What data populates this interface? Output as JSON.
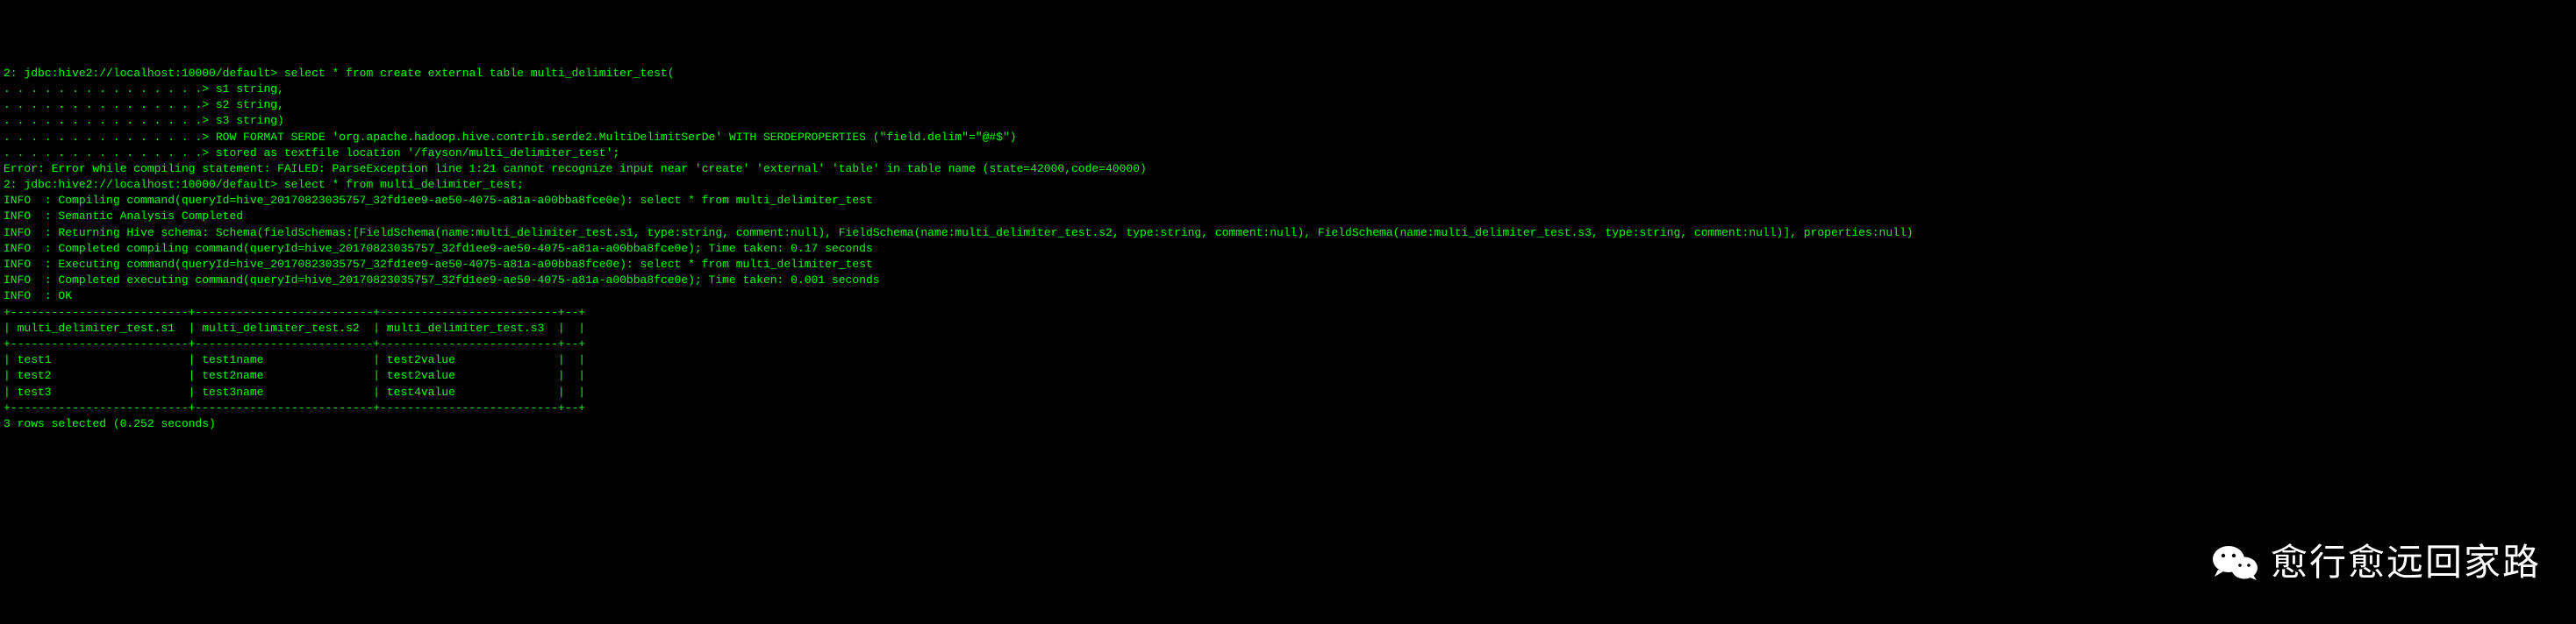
{
  "prompt1": "2: jdbc:hive2://localhost:10000/default> ",
  "cont": ". . . . . . . . . . . . . . .> ",
  "sql_create": {
    "l1": "select * from create external table multi_delimiter_test(",
    "l2": "s1 string,",
    "l3": "s2 string,",
    "l4": "s3 string)",
    "l5": "ROW FORMAT SERDE 'org.apache.hadoop.hive.contrib.serde2.MultiDelimitSerDe' WITH SERDEPROPERTIES (\"field.delim\"=\"@#$\")",
    "l6": "stored as textfile location '/fayson/multi_delimiter_test';"
  },
  "error": "Error: Error while compiling statement: FAILED: ParseException line 1:21 cannot recognize input near 'create' 'external' 'table' in table name (state=42000,code=40000)",
  "sql_select": "select * from multi_delimiter_test;",
  "info": {
    "compiling": "INFO  : Compiling command(queryId=hive_20170823035757_32fd1ee9-ae50-4075-a81a-a00bba8fce0e): select * from multi_delimiter_test",
    "semantic": "INFO  : Semantic Analysis Completed",
    "schema": "INFO  : Returning Hive schema: Schema(fieldSchemas:[FieldSchema(name:multi_delimiter_test.s1, type:string, comment:null), FieldSchema(name:multi_delimiter_test.s2, type:string, comment:null), FieldSchema(name:multi_delimiter_test.s3, type:string, comment:null)], properties:null)",
    "completed_compile": "INFO  : Completed compiling command(queryId=hive_20170823035757_32fd1ee9-ae50-4075-a81a-a00bba8fce0e); Time taken: 0.17 seconds",
    "executing": "INFO  : Executing command(queryId=hive_20170823035757_32fd1ee9-ae50-4075-a81a-a00bba8fce0e): select * from multi_delimiter_test",
    "completed_exec": "INFO  : Completed executing command(queryId=hive_20170823035757_32fd1ee9-ae50-4075-a81a-a00bba8fce0e); Time taken: 0.001 seconds",
    "ok": "INFO  : OK"
  },
  "table": {
    "border": "+--------------------------+--------------------------+--------------------------+--+",
    "header": "| multi_delimiter_test.s1  | multi_delimiter_test.s2  | multi_delimiter_test.s3  |  |",
    "rows": [
      "| test1                    | test1name                | test2value               |  |",
      "| test2                    | test2name                | test2value               |  |",
      "| test3                    | test3name                | test4value               |  |"
    ]
  },
  "footer": "3 rows selected (0.252 seconds)",
  "watermark": "愈行愈远回家路",
  "chart_data": {
    "type": "table",
    "columns": [
      "multi_delimiter_test.s1",
      "multi_delimiter_test.s2",
      "multi_delimiter_test.s3"
    ],
    "rows": [
      [
        "test1",
        "test1name",
        "test2value"
      ],
      [
        "test2",
        "test2name",
        "test2value"
      ],
      [
        "test3",
        "test3name",
        "test4value"
      ]
    ],
    "rows_selected": 3,
    "elapsed_seconds": 0.252
  }
}
